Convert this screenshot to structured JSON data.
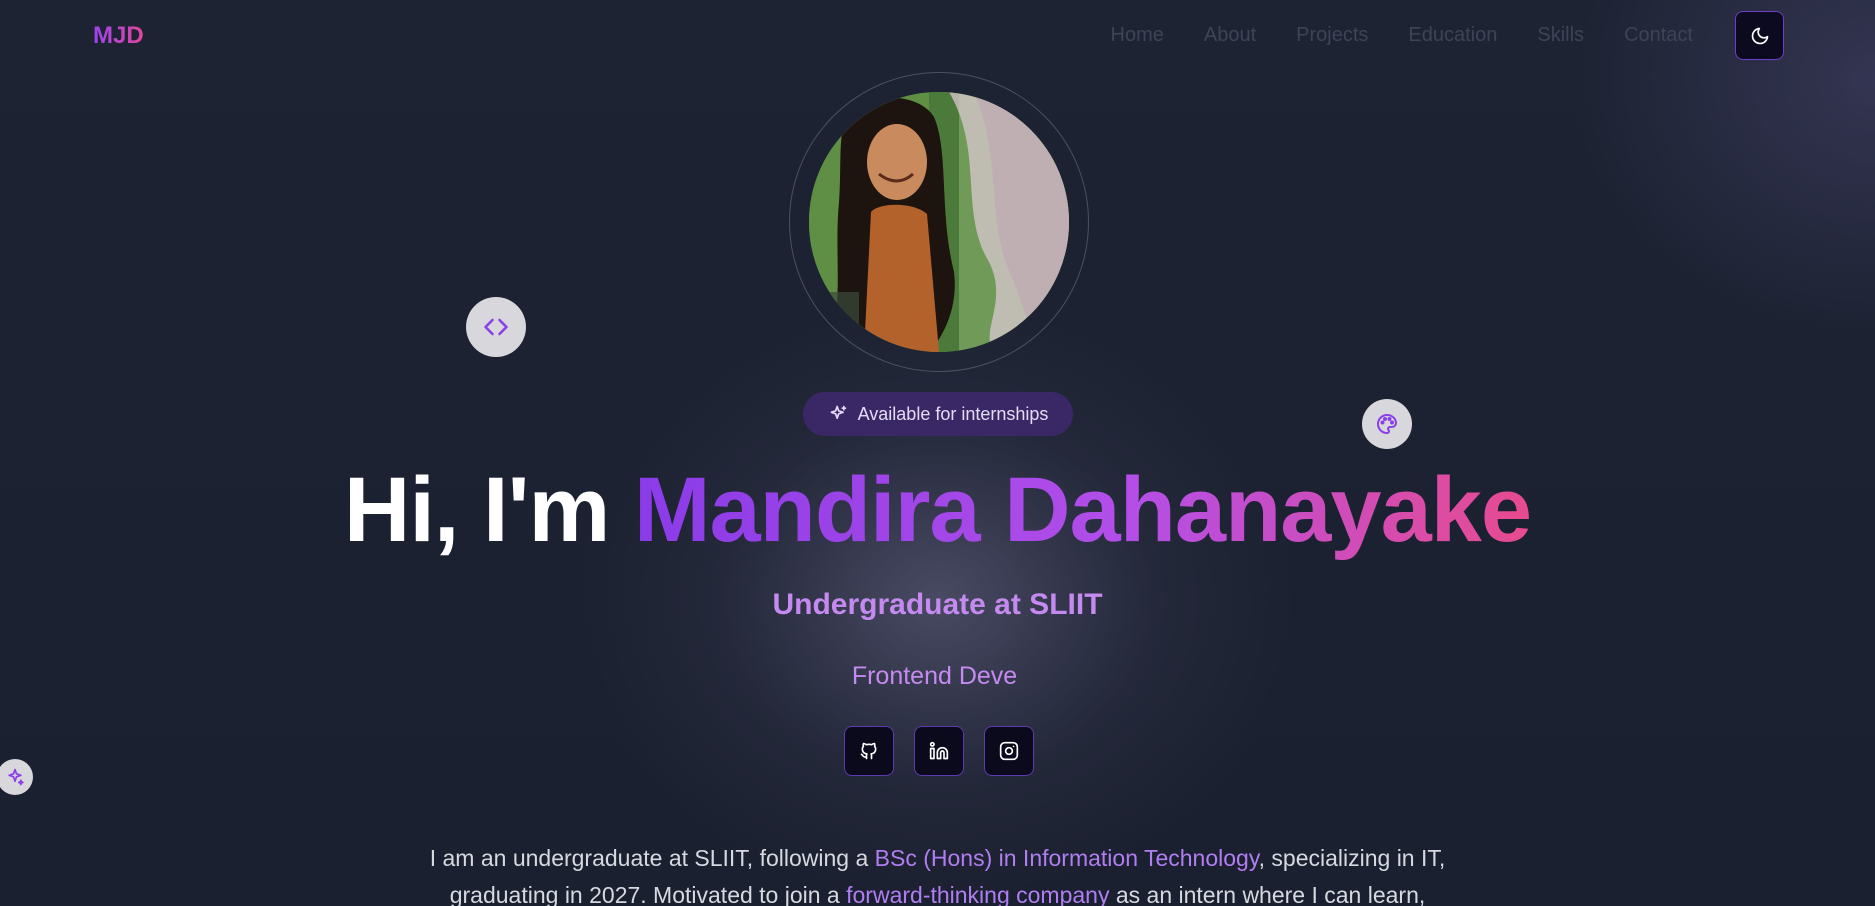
{
  "nav": {
    "logo": "MJD",
    "links": [
      "Home",
      "About",
      "Projects",
      "Education",
      "Skills",
      "Contact"
    ],
    "theme_icon": "moon-icon"
  },
  "hero": {
    "badge": "Available for internships",
    "greeting": "Hi, I'm ",
    "name": "Mandira Dahanayake",
    "subtitle": "Undergraduate at SLIIT",
    "typing_text": "Frontend Deve",
    "floating_icons": [
      "code-icon",
      "palette-icon",
      "sparkles-icon"
    ],
    "socials": [
      {
        "name": "GitHub",
        "icon": "github-icon"
      },
      {
        "name": "LinkedIn",
        "icon": "linkedin-icon"
      },
      {
        "name": "Instagram",
        "icon": "instagram-icon"
      }
    ]
  },
  "bio": {
    "line1_a": "I am an undergraduate at SLIIT, following a ",
    "line1_hl": "BSc (Hons) in Information Technology",
    "line1_b": ", specializing in IT,",
    "line2_a": "graduating in 2027. Motivated to join a ",
    "line2_hl": "forward-thinking company",
    "line2_b": " as an intern where I can learn,"
  },
  "colors": {
    "accent_purple": "#9b44f0",
    "accent_pink": "#e84b8f",
    "background": "#1c2130"
  }
}
